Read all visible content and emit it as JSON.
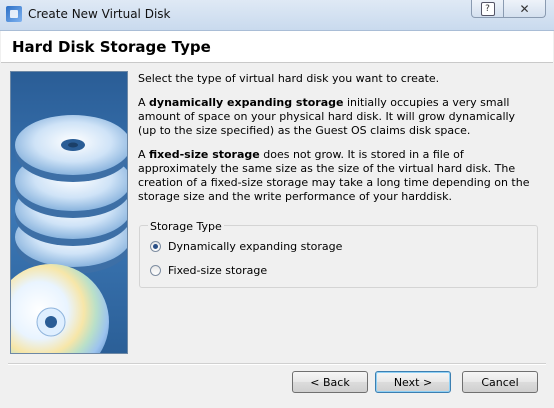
{
  "window": {
    "title": "Create New Virtual Disk",
    "help_label": "?",
    "close_label": "✕"
  },
  "header": {
    "title": "Hard Disk Storage Type"
  },
  "intro": "Select the type of virtual hard disk you want to create.",
  "dynamic": {
    "term": "dynamically expanding storage",
    "prefix": "A ",
    "description": " initially occupies a very small amount of space on your physical hard disk. It will grow dynamically (up to the size specified) as the Guest OS claims disk space."
  },
  "fixed": {
    "term": "fixed-size storage",
    "prefix": "A ",
    "description": " does not grow. It is stored in a file of approximately the same size as the size of the virtual hard disk. The creation of a fixed-size storage may take a long time depending on the storage size and the write performance of your harddisk."
  },
  "storage_type": {
    "legend": "Storage Type",
    "options": [
      {
        "label": "Dynamically expanding storage",
        "selected": true
      },
      {
        "label": "Fixed-size storage",
        "selected": false
      }
    ]
  },
  "buttons": {
    "back": "< Back",
    "next": "Next >",
    "cancel": "Cancel"
  },
  "colors": {
    "art_bg": "#3c78b6",
    "default_button_border": "#3c7fb1"
  }
}
